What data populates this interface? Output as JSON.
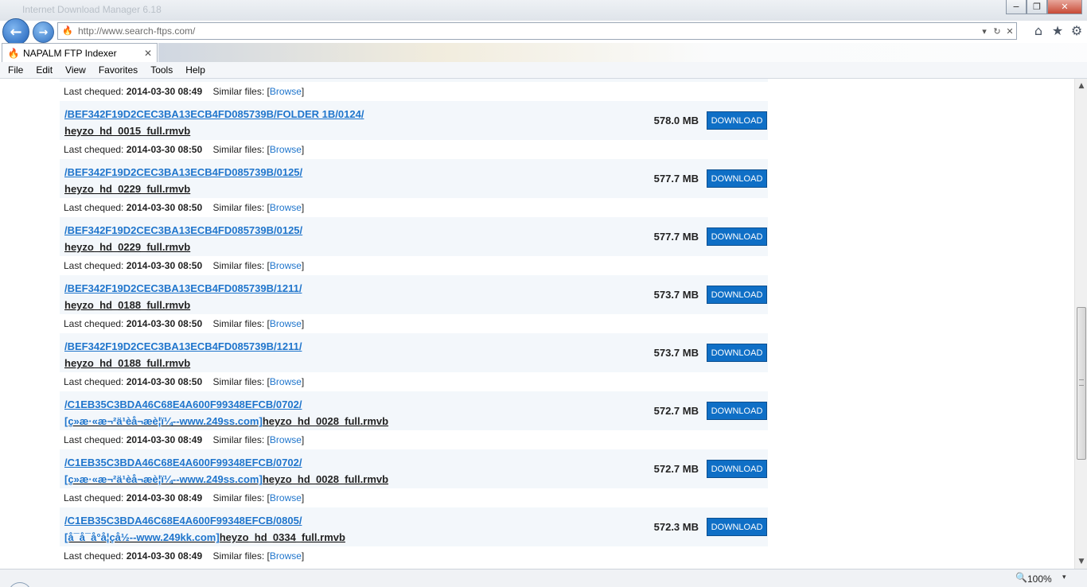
{
  "window": {
    "title_faded": "Internet Download Manager 6.18",
    "controls": {
      "minimize": "−",
      "maximize": "❐",
      "close": "✕"
    }
  },
  "nav": {
    "back_icon": "←",
    "forward_icon": "→",
    "url": "http://www.search-ftps.com/",
    "address_dropdown": "▾",
    "refresh_icon": "↻",
    "stop_icon": "✕",
    "home_icon": "⌂",
    "favorites_icon": "★",
    "tools_icon": "⚙"
  },
  "tab": {
    "title": "NAPALM FTP Indexer",
    "close": "✕",
    "favicon": "🔥"
  },
  "menu": [
    "File",
    "Edit",
    "View",
    "Favorites",
    "Tools",
    "Help"
  ],
  "results": [
    {
      "path": "",
      "prefix": "",
      "filename": "",
      "size": "",
      "button": "",
      "date": "2014-03-30 08:49",
      "partial": true
    },
    {
      "path": "/BEF342F19D2CEC3BA13ECB4FD085739B/FOLDER 1B/0124/",
      "prefix": "",
      "filename": "heyzo_hd_0015_full.rmvb",
      "size": "578.0 MB",
      "button": "DOWNLOAD",
      "date": "2014-03-30 08:50"
    },
    {
      "path": "/BEF342F19D2CEC3BA13ECB4FD085739B/0125/",
      "prefix": "",
      "filename": "heyzo_hd_0229_full.rmvb",
      "size": "577.7 MB",
      "button": "DOWNLOAD",
      "date": "2014-03-30 08:50"
    },
    {
      "path": "/BEF342F19D2CEC3BA13ECB4FD085739B/0125/",
      "prefix": "",
      "filename": "heyzo_hd_0229_full.rmvb",
      "size": "577.7 MB",
      "button": "DOWNLOAD",
      "date": "2014-03-30 08:50"
    },
    {
      "path": "/BEF342F19D2CEC3BA13ECB4FD085739B/1211/",
      "prefix": "",
      "filename": "heyzo_hd_0188_full.rmvb",
      "size": "573.7 MB",
      "button": "DOWNLOAD",
      "date": "2014-03-30 08:50"
    },
    {
      "path": "/BEF342F19D2CEC3BA13ECB4FD085739B/1211/",
      "prefix": "",
      "filename": "heyzo_hd_0188_full.rmvb",
      "size": "573.7 MB",
      "button": "DOWNLOAD",
      "date": "2014-03-30 08:50"
    },
    {
      "path": "/C1EB35C3BDA46C68E4A600F99348EFCB/0702/",
      "prefix": "[ç»æ·«æ¬²ä¹èå¬æè¦ï¼--www.249ss.com]",
      "filename": "heyzo_hd_0028_full.rmvb",
      "size": "572.7 MB",
      "button": "DOWNLOAD",
      "date": "2014-03-30 08:49"
    },
    {
      "path": "/C1EB35C3BDA46C68E4A600F99348EFCB/0702/",
      "prefix": "[ç»æ·«æ¬²ä¹èå¬æè¦ï¼--www.249ss.com]",
      "filename": "heyzo_hd_0028_full.rmvb",
      "size": "572.7 MB",
      "button": "DOWNLOAD",
      "date": "2014-03-30 08:49"
    },
    {
      "path": "/C1EB35C3BDA46C68E4A600F99348EFCB/0805/",
      "prefix": "[å¯å¯å°å¦çå½--www.249kk.com]",
      "filename": "heyzo_hd_0334_full.rmvb",
      "size": "572.3 MB",
      "button": "DOWNLOAD",
      "date": "2014-03-30 08:49"
    }
  ],
  "labels": {
    "last_checked": "Last chequed:",
    "similar_files": "Similar files:",
    "browse": "Browse",
    "bracket_open": "[",
    "bracket_close": "]"
  },
  "status": {
    "zoom": "100%",
    "zoom_icon": "🔍",
    "zoom_arrow": "▾"
  },
  "scrollbar": {
    "up": "▲",
    "down": "▼"
  }
}
